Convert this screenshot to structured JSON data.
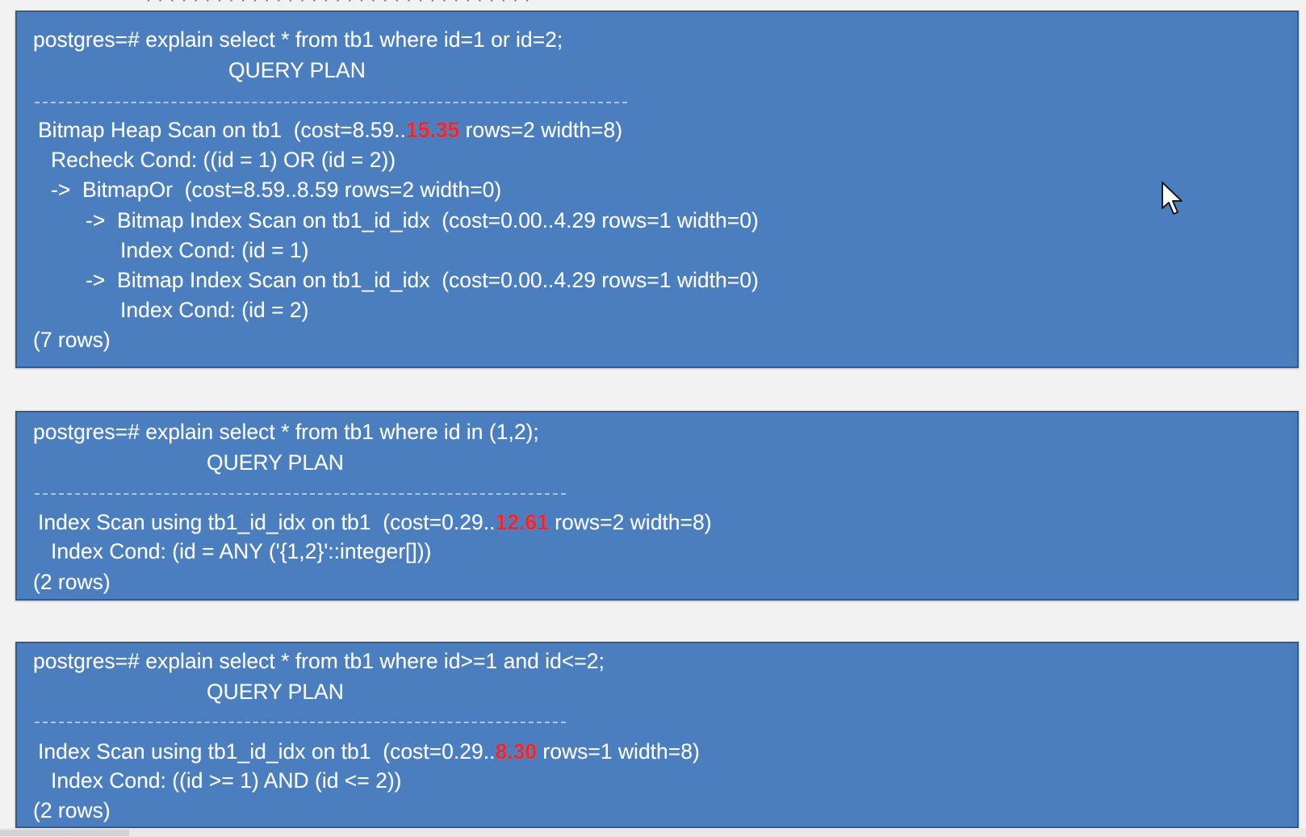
{
  "top_clip": "· · · · · · · · · · · · · · · · · · · · · · · · · · · · · · · · ·",
  "panels": [
    {
      "prompt": "postgres=# explain select * from tb1 where id=1 or id=2;",
      "header": "QUERY PLAN",
      "rule": "------------------------------------------------------------------------------------------",
      "plan_line_1": {
        "before": "Bitmap Heap Scan on tb1  (cost=8.59..",
        "highlight": "15.35",
        "after": " rows=2 width=8)"
      },
      "plan_lines": [
        "Recheck Cond: ((id = 1) OR (id = 2))",
        "->  BitmapOr  (cost=8.59..8.59 rows=2 width=0)",
        "->  Bitmap Index Scan on tb1_id_idx  (cost=0.00..4.29 rows=1 width=0)",
        "Index Cond: (id = 1)",
        "->  Bitmap Index Scan on tb1_id_idx  (cost=0.00..4.29 rows=1 width=0)",
        "Index Cond: (id = 2)"
      ],
      "footer": "(7 rows)"
    },
    {
      "prompt": "postgres=# explain select * from tb1 where id in (1,2);",
      "header": "QUERY PLAN",
      "rule": "------------------------------------------------------------------------------------",
      "plan_line_1": {
        "before": "Index Scan using tb1_id_idx on tb1  (cost=0.29..",
        "highlight": "12.61",
        "after": " rows=2 width=8)"
      },
      "plan_lines": [
        "Index Cond: (id = ANY ('{1,2}'::integer[]))"
      ],
      "footer": "(2 rows)"
    },
    {
      "prompt": "postgres=# explain select * from tb1 where id>=1 and id<=2;",
      "header": "QUERY PLAN",
      "rule": "------------------------------------------------------------------------------------",
      "plan_line_1": {
        "before": "Index Scan using tb1_id_idx on tb1  (cost=0.29..",
        "highlight": "8.30",
        "after": " rows=1 width=8)"
      },
      "plan_lines": [
        "Index Cond: ((id >= 1) AND (id <= 2))"
      ],
      "footer": "(2 rows)"
    }
  ],
  "colors": {
    "panel_bg": "#4a7ebf",
    "panel_border": "#2f5c93",
    "text": "#ffffff",
    "highlight": "#ff1f1f",
    "page_bg": "#f2f2f3"
  },
  "icons": {
    "cursor": "mouse-pointer-icon"
  }
}
